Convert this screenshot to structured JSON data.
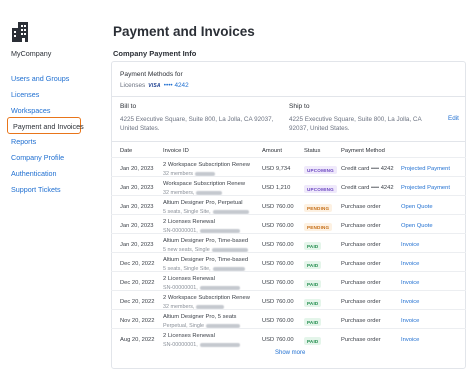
{
  "sidebar": {
    "company": "MyCompany",
    "items": [
      {
        "label": "Users and Groups"
      },
      {
        "label": "Licenses"
      },
      {
        "label": "Workspaces"
      },
      {
        "label": "Payment and Invoices"
      },
      {
        "label": "Reports"
      },
      {
        "label": "Company Profile"
      },
      {
        "label": "Authentication"
      },
      {
        "label": "Support Tickets"
      }
    ]
  },
  "page": {
    "title": "Payment and Invoices",
    "section_title": "Company Payment Info"
  },
  "payment": {
    "methods_title": "Payment Methods for",
    "licenses_label": "Licenses",
    "card_brand": "VISA",
    "card_number": "•••• 4242"
  },
  "billing": {
    "bill_to_label": "Bill to",
    "bill_to_address": "4225 Executive Square, Suite 800, La Jolla, CA 92037, United States.",
    "ship_to_label": "Ship to",
    "ship_to_address": "4225 Executive Square, Suite 800, La Jolla, CA 92037, United States.",
    "edit_label": "Edit"
  },
  "table": {
    "columns": [
      "Date",
      "Invoice ID",
      "Amount",
      "Status",
      "Payment Method"
    ],
    "rows": [
      {
        "date": "Jan 20, 2023",
        "title": "2 Workspace Subscription Renew",
        "sub": "32 members",
        "amount": "USD 9,734",
        "status": "UPCOMING",
        "method": "Credit card •••• 4242",
        "action": "Projected Payment"
      },
      {
        "date": "Jan 20, 2023",
        "title": "Workspace Subscription Renew",
        "sub": "32 members,",
        "amount": "USD 1,210",
        "status": "UPCOMING",
        "method": "Credit card •••• 4242",
        "action": "Projected Payment"
      },
      {
        "date": "Jan 20, 2023",
        "title": "Altium Designer Pro, Perpetual",
        "sub": "5 seats, Single Site,",
        "amount": "USD 760.00",
        "status": "PENDING",
        "method": "Purchase order",
        "action": "Open Quote"
      },
      {
        "date": "Jan 20, 2023",
        "title": "2 Licenses Renewal",
        "sub": "SN-00000001,",
        "amount": "USD 760.00",
        "status": "PENDING",
        "method": "Purchase order",
        "action": "Open Quote"
      },
      {
        "date": "Jan 20, 2023",
        "title": "Altium Designer Pro, Time-based",
        "sub": "5 new seats, Single",
        "amount": "USD 760.00",
        "status": "PAID",
        "method": "Purchase order",
        "action": "Invoice"
      },
      {
        "date": "Dec 20, 2022",
        "title": "Altium Designer Pro, Time-based",
        "sub": "5 seats, Single Site,",
        "amount": "USD 760.00",
        "status": "PAID",
        "method": "Purchase order",
        "action": "Invoice"
      },
      {
        "date": "Dec 20, 2022",
        "title": "2 Licenses Renewal",
        "sub": "SN-00000001,",
        "amount": "USD 760.00",
        "status": "PAID",
        "method": "Purchase order",
        "action": "Invoice"
      },
      {
        "date": "Dec 20, 2022",
        "title": "2 Workspace Subscription Renew",
        "sub": "32 members,",
        "amount": "USD 760.00",
        "status": "PAID",
        "method": "Purchase order",
        "action": "Invoice"
      },
      {
        "date": "Nov 20, 2022",
        "title": "Altium Designer Pro, 5 seats",
        "sub": "Perpetual, Single",
        "amount": "USD 760.00",
        "status": "PAID",
        "method": "Purchase order",
        "action": "Invoice"
      },
      {
        "date": "Aug 20, 2022",
        "title": "2 Licenses Renewal",
        "sub": "SN-00000001,",
        "amount": "USD 760.00",
        "status": "PAID",
        "method": "Purchase order",
        "action": "Invoice"
      }
    ],
    "show_more": "Show more"
  },
  "colors": {
    "accent": "#1f6fd1",
    "active_outline": "#e8751a",
    "upcoming": "#6b46c1",
    "pending": "#c46b12",
    "paid": "#1d8a4a"
  },
  "icons": {
    "logo": "building-logo-icon"
  }
}
